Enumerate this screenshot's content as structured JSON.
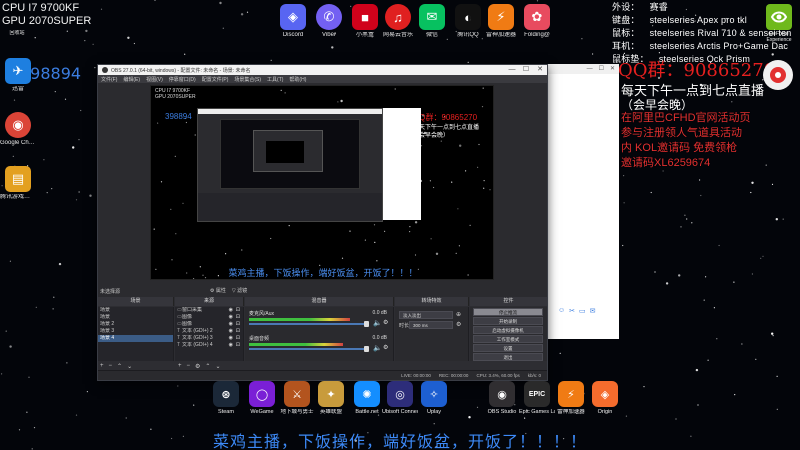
{
  "colors": {
    "background": "#03050a",
    "accent_red": "#e6201f",
    "obs_dark": "#2b2b2f",
    "selection_blue": "#3b5c86"
  },
  "system_info": {
    "cpu": "CPU I7 9700KF",
    "gpu": "GPU 2070SUPER",
    "recycle_bin": "回收站"
  },
  "qq_number_left": "398894",
  "desktop_left_icons": [
    {
      "label": "迅雷",
      "icon": "xunlei-icon",
      "color": "#1e7fe0"
    },
    {
      "label": "Google Chrome",
      "icon": "chrome-icon",
      "color": "#db4437"
    },
    {
      "label": "腾讯游戏助手.exe",
      "icon": "archive-icon",
      "color": "#e3a020"
    }
  ],
  "desktop_top_icons": [
    {
      "label": "Discord",
      "icon": "discord-icon",
      "color": "#5865f2"
    },
    {
      "label": "Viber",
      "icon": "viber-icon",
      "color": "#7360f2"
    },
    {
      "label": "小黑盒",
      "icon": "heybox-icon",
      "color": "#d0021b"
    },
    {
      "label": "网易云音乐",
      "icon": "netease-music-icon",
      "color": "#e02020"
    },
    {
      "label": "微信",
      "icon": "wechat-icon",
      "color": "#07c160"
    },
    {
      "label": "腾讯QQ",
      "icon": "qq-icon",
      "color": "#111111"
    },
    {
      "label": "雷神加速器",
      "icon": "leishen-icon",
      "color": "#f07b14"
    },
    {
      "label": "Folding@",
      "icon": "folding-icon",
      "color": "#e84b5f"
    }
  ],
  "gear_info": [
    {
      "key": "外设：",
      "value": "赛睿"
    },
    {
      "key": "键盘：",
      "value": "steelseries Apex pro tkl"
    },
    {
      "key": "鼠标：",
      "value": "steelseries Rival 710 & sensei ten"
    },
    {
      "key": "耳机：",
      "value": "steelseries Arctis Pro+Game Dac"
    },
    {
      "key": "鼠标垫：",
      "value": "steelseries Qck Prism"
    }
  ],
  "nvidia_label": "GeForce Experience",
  "qq_group": "QQ群：90865270",
  "schedule_line1": "每天下午一点到七点直播",
  "schedule_line2": "（会早会晚）",
  "promo_lines": [
    "在阿里巴CFHD官网活动页",
    "参与注册领人气道具活动",
    "内 KOL邀请码 免费领枪",
    "邀请码XL6259674"
  ],
  "obs": {
    "title": "OBS 27.0.1 (64-bit, windows) - 配置文件: 未命名 - 场景: 未命名",
    "menu": [
      "文件(F)",
      "编辑(E)",
      "视图(V)",
      "停靠窗口(D)",
      "配置文件(P)",
      "场景集合(S)",
      "工具(T)",
      "帮助(H)"
    ],
    "no_source_selected": "未选择源",
    "properties_label": "属性",
    "filters_label": "滤镜",
    "docks": {
      "scenes": "场景",
      "sources": "来源",
      "mixer": "混音器",
      "transitions": "转场特效",
      "controls": "控件"
    },
    "scenes": [
      "场景",
      "场景",
      "场景 2",
      "场景 3",
      "场景 4"
    ],
    "selected_scene": 4,
    "sources": [
      "窗口采集",
      "图像",
      "图像",
      "文本 (GDI+) 2",
      "文本 (GDI+) 3",
      "文本 (GDI+) 4"
    ],
    "mixer_tracks": [
      {
        "name": "麦克风/Aux",
        "db": "0.0 dB",
        "level": 0.86
      },
      {
        "name": "桌面音频",
        "db": "0.0 dB",
        "level": 0.8
      }
    ],
    "transition": {
      "type": "淡入淡出",
      "duration_label": "时长",
      "duration": "300 ms"
    },
    "controls": [
      "停止推流",
      "开始录制",
      "启动虚拟摄像机",
      "工作室模式",
      "设置",
      "退出"
    ],
    "status": {
      "live": "LIVE: 00:00:00",
      "rec": "REC: 00:00:00",
      "cpu": "CPU: 3.4%, 60.00 fps",
      "kbps": "kb/s: 0"
    }
  },
  "preview_banner": "菜鸡主播，下饭操作，端好饭盆，开饭了！！！",
  "game_bar": [
    {
      "label": "Steam",
      "icon": "steam-icon",
      "color": "#1b2838"
    },
    {
      "label": "WeGame",
      "icon": "wegame-icon",
      "color": "#7a1fd6"
    },
    {
      "label": "地下城与勇士",
      "icon": "dnf-icon",
      "color": "#b3541e"
    },
    {
      "label": "英雄联盟",
      "icon": "lol-icon",
      "color": "#c89b3c"
    },
    {
      "label": "Battle.net",
      "icon": "battlenet-icon",
      "color": "#148eff"
    },
    {
      "label": "Ubisoft Connect",
      "icon": "ubisoft-icon",
      "color": "#2d2d7a"
    },
    {
      "label": "Uplay",
      "icon": "uplay-icon",
      "color": "#1d5fd1"
    },
    {
      "label": "OBS Studio",
      "icon": "obs-icon",
      "color": "#302e31"
    },
    {
      "label": "Epic Games Launcher",
      "icon": "epic-icon",
      "color": "#2a2a2a"
    },
    {
      "label": "雷神加速器",
      "icon": "leishen-icon",
      "color": "#f07b14"
    },
    {
      "label": "Origin",
      "icon": "origin-icon",
      "color": "#f56c2d"
    }
  ],
  "bottom_banner": "菜鸡主播，下饭操作，端好饭盆，开饭了！！！！"
}
